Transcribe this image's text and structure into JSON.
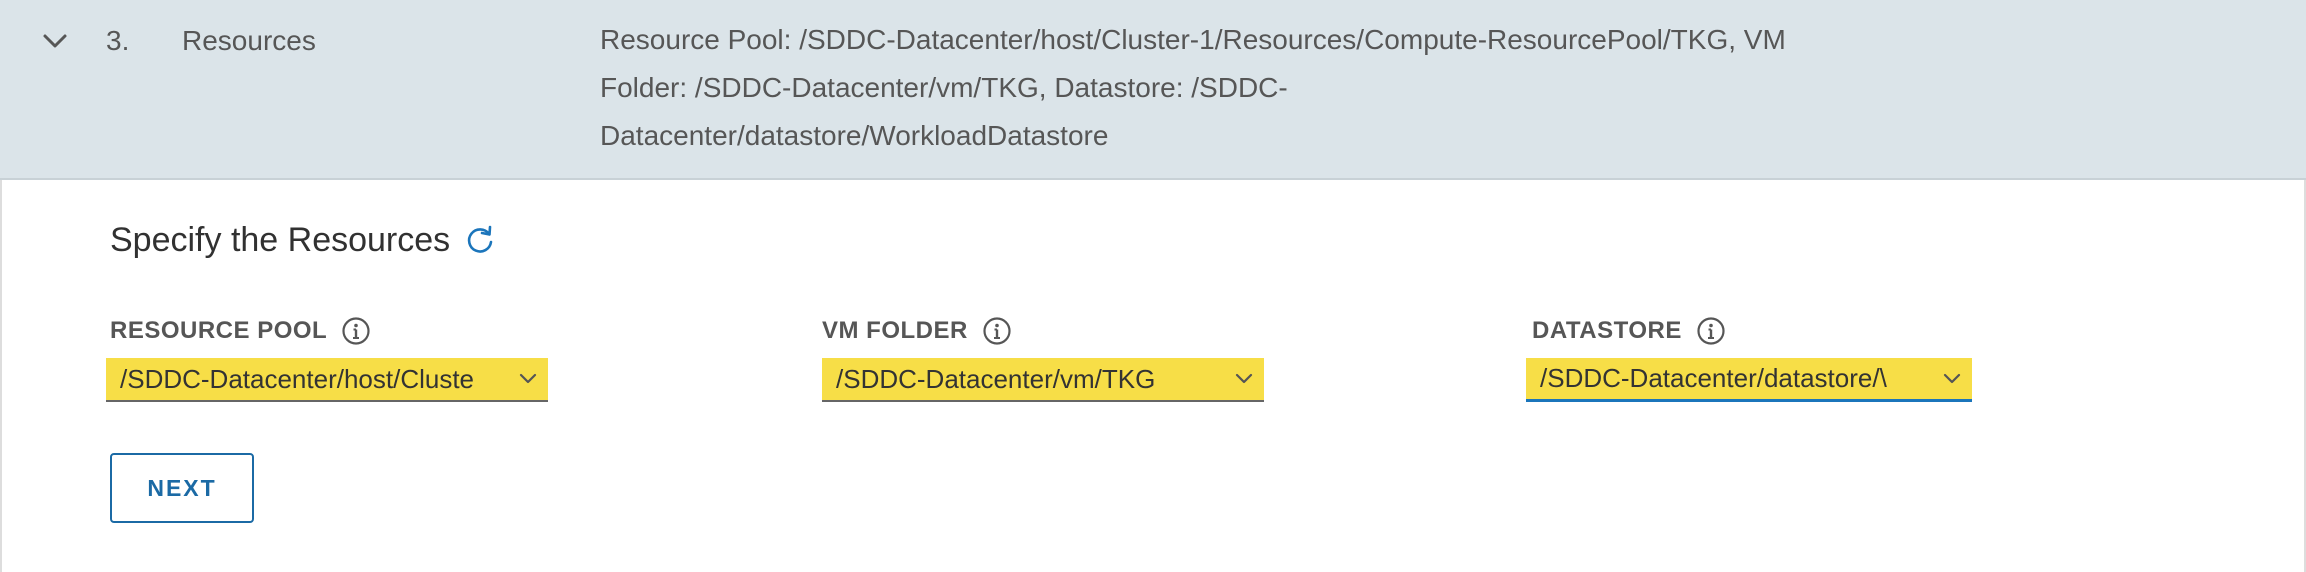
{
  "step": {
    "number": "3.",
    "title": "Resources",
    "summary_line1": "Resource Pool: /SDDC-Datacenter/host/Cluster-1/Resources/Compute-ResourcePool/TKG, VM",
    "summary_line2": "Folder: /SDDC-Datacenter/vm/TKG, Datastore: /SDDC-",
    "summary_line3": "Datacenter/datastore/WorkloadDatastore",
    "chevron_icon": "chevron-down-icon"
  },
  "section": {
    "title": "Specify the Resources",
    "refresh_icon": "refresh-icon"
  },
  "fields": {
    "resource_pool": {
      "label": "RESOURCE POOL",
      "value": "/SDDC-Datacenter/host/Cluste"
    },
    "vm_folder": {
      "label": "VM FOLDER",
      "value": "/SDDC-Datacenter/vm/TKG"
    },
    "datastore": {
      "label": "DATASTORE",
      "value": "/SDDC-Datacenter/datastore/\\"
    }
  },
  "actions": {
    "next_label": "NEXT"
  },
  "colors": {
    "header_bg": "#dbe4e9",
    "select_highlight": "#f7de47",
    "accent": "#1b6aa5",
    "refresh": "#1b75bb"
  }
}
